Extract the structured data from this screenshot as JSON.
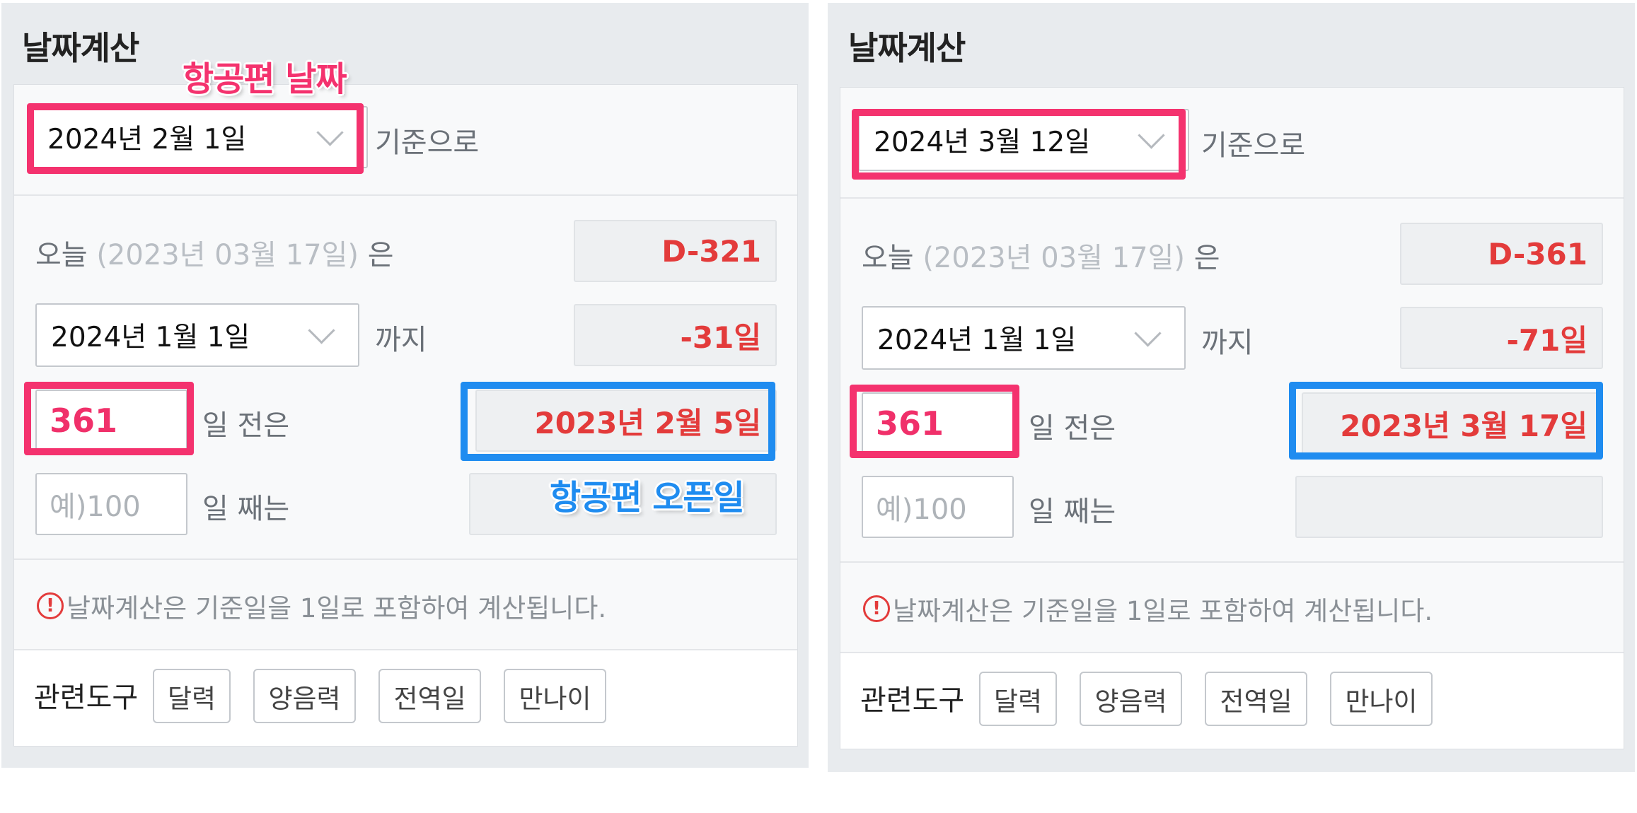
{
  "panels": [
    {
      "title": "날짜계산",
      "base_date": "2024년 2월 1일",
      "base_suffix": "기준으로",
      "today_prefix": "오늘",
      "today_date": "(2023년 03월 17일)",
      "today_suffix": "은",
      "today_result": "D-321",
      "until_date": "2024년 1월 1일",
      "until_suffix": "까지",
      "until_result": "-31일",
      "days_before_value": "361",
      "days_before_suffix": "일  전은",
      "days_before_result": "2023년 2월 5일",
      "days_nth_placeholder": "예)100",
      "days_nth_suffix": "일  째는",
      "days_nth_result": "",
      "notice_icon": "exclamation-circle-icon",
      "notice": "날짜계산은 기준일을 1일로 포함하여 계산됩니다.",
      "tools_label": "관련도구",
      "tools": [
        "달력",
        "양음력",
        "전역일",
        "만나이"
      ],
      "annotation_top": "항공편 날짜",
      "annotation_bottom": "항공편 오픈일"
    },
    {
      "title": "날짜계산",
      "base_date": "2024년 3월 12일",
      "base_suffix": "기준으로",
      "today_prefix": "오늘",
      "today_date": "(2023년 03월 17일)",
      "today_suffix": "은",
      "today_result": "D-361",
      "until_date": "2024년 1월 1일",
      "until_suffix": "까지",
      "until_result": "-71일",
      "days_before_value": "361",
      "days_before_suffix": "일  전은",
      "days_before_result": "2023년 3월 17일",
      "days_nth_placeholder": "예)100",
      "days_nth_suffix": "일  째는",
      "days_nth_result": "",
      "notice_icon": "exclamation-circle-icon",
      "notice": "날짜계산은 기준일을 1일로 포함하여 계산됩니다.",
      "tools_label": "관련도구",
      "tools": [
        "달력",
        "양음력",
        "전역일",
        "만나이"
      ]
    }
  ],
  "colors": {
    "result_red": "#e33b3b",
    "highlight_pink": "#f4326e",
    "highlight_blue": "#1f8cf0"
  }
}
